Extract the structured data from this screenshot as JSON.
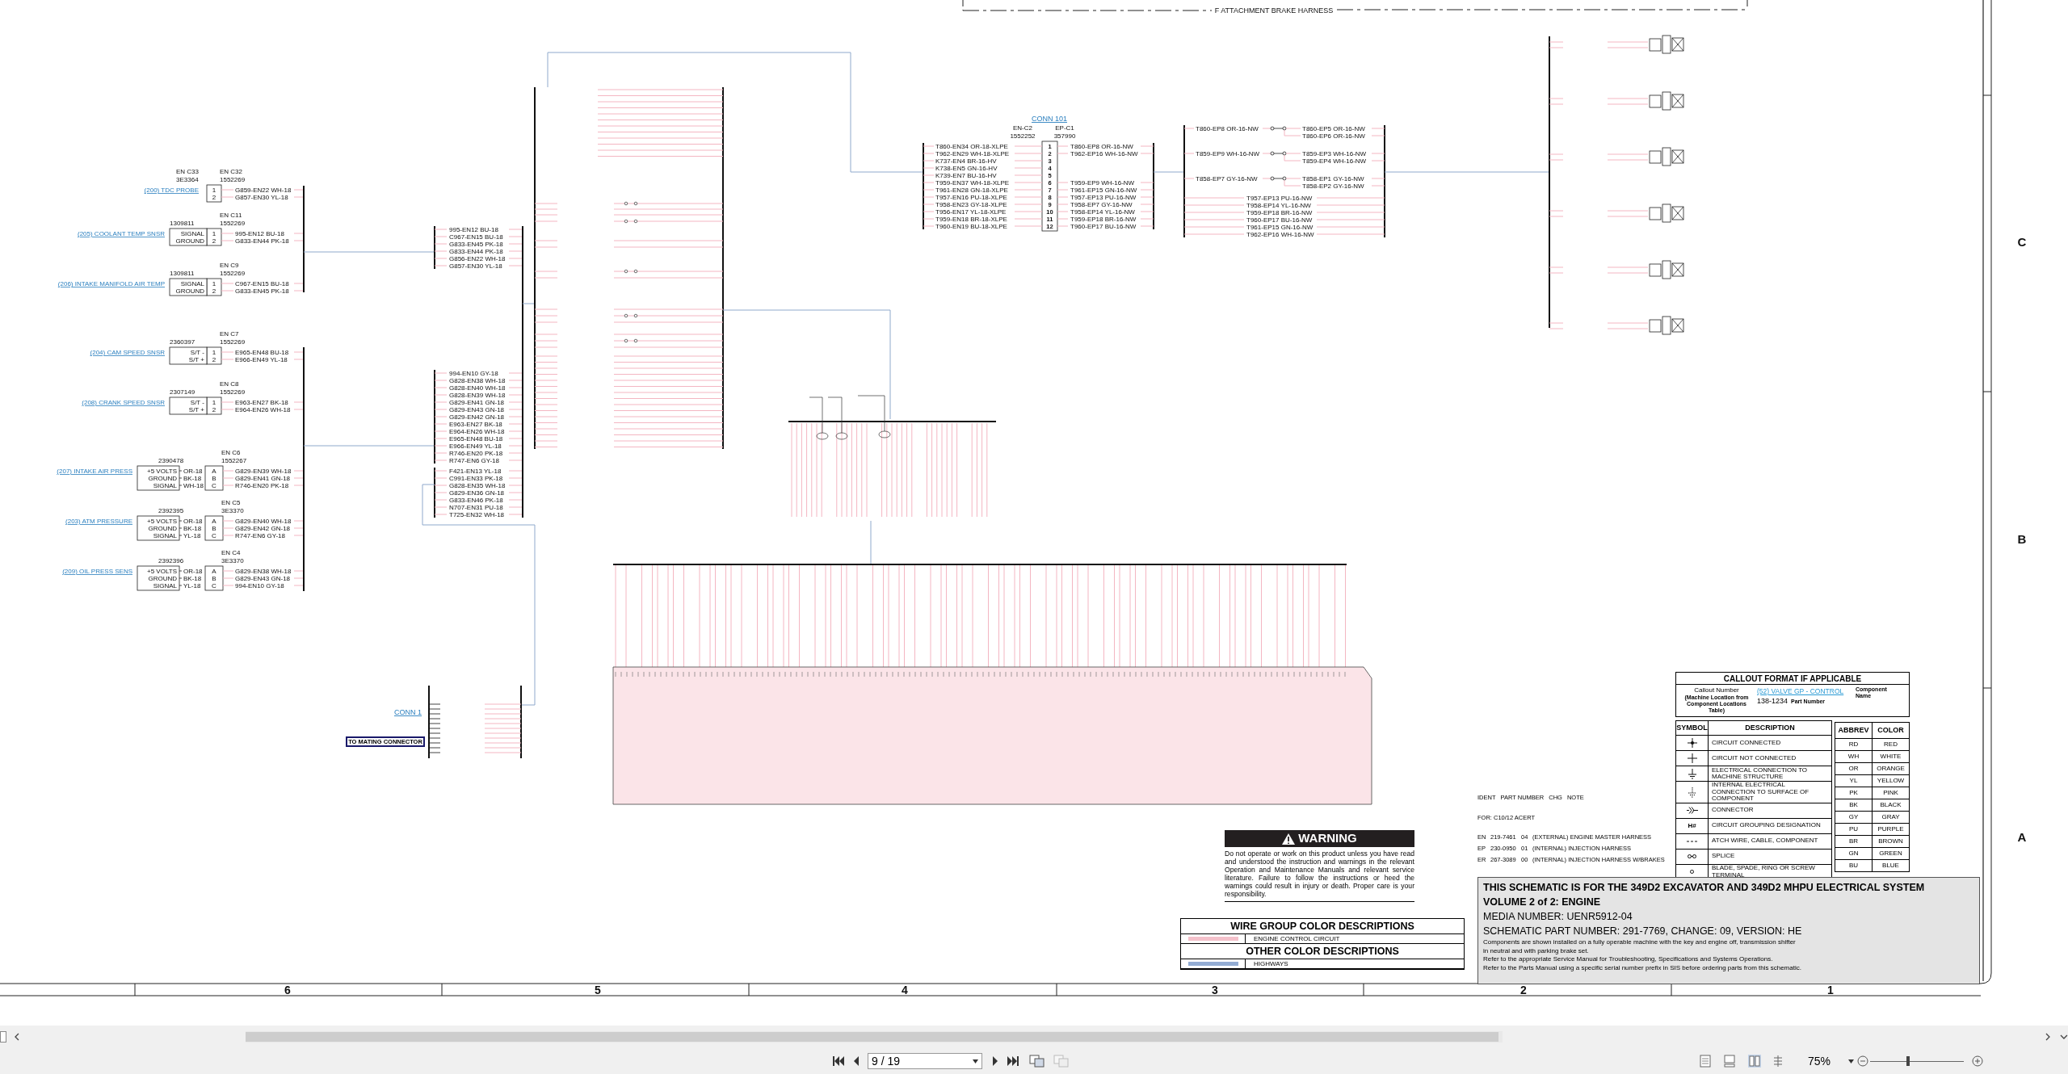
{
  "harness_frame": {
    "label": "F ATTACHMENT BRAKE HARNESS"
  },
  "sensors": [
    {
      "kind": "probe",
      "link": "(200) TDC PROBE",
      "ident": "EN C33",
      "part": "3E3364",
      "connector": "EN C32",
      "connector_part": "1552269",
      "pins": [
        "1",
        "2"
      ],
      "wires": [
        "G859-EN22 WH-18",
        "G857-EN30 YL-18"
      ]
    },
    {
      "kind": "two_wire",
      "link": "(205) COOLANT TEMP SNSR",
      "part": "1309811",
      "connector": "EN C11",
      "connector_part": "1552269",
      "signals": [
        "SIGNAL",
        "GROUND"
      ],
      "pins": [
        "1",
        "2"
      ],
      "wires": [
        "995-EN12 BU-18",
        "G833-EN44 PK-18"
      ]
    },
    {
      "kind": "two_wire",
      "link": "(206) INTAKE MANIFOLD AIR TEMP",
      "part": "1309811",
      "connector": "EN C9",
      "connector_part": "1552269",
      "signals": [
        "SIGNAL",
        "GROUND"
      ],
      "pins": [
        "1",
        "2"
      ],
      "wires": [
        "C967-EN15 BU-18",
        "G833-EN45 PK-18"
      ]
    },
    {
      "kind": "two_wire",
      "link": "(204) CAM SPEED SNSR",
      "part": "2360397",
      "connector": "EN C7",
      "connector_part": "1552269",
      "signals": [
        "S/T -",
        "S/T +"
      ],
      "pins": [
        "1",
        "2"
      ],
      "wires": [
        "E965-EN48 BU-18",
        "E966-EN49 YL-18"
      ]
    },
    {
      "kind": "two_wire",
      "link": "(208) CRANK SPEED SNSR",
      "part": "2307149",
      "connector": "EN C8",
      "connector_part": "1552269",
      "signals": [
        "S/T -",
        "S/T +"
      ],
      "pins": [
        "1",
        "2"
      ],
      "wires": [
        "E963-EN27 BK-18",
        "E964-EN26 WH-18"
      ]
    },
    {
      "kind": "three_wire",
      "link": "(207) INTAKE AIR PRESS",
      "part": "2390478",
      "connector": "EN C6",
      "connector_part": "1552267",
      "signals": [
        {
          "name": "+5 VOLTS",
          "wire": "OR-18"
        },
        {
          "name": "GROUND",
          "wire": "BK-18"
        },
        {
          "name": "SIGNAL",
          "wire": "WH-18"
        }
      ],
      "pins": [
        "A",
        "B",
        "C"
      ],
      "wires": [
        "G829-EN39 WH-18",
        "G829-EN41 GN-18",
        "R746-EN20 PK-18"
      ]
    },
    {
      "kind": "three_wire",
      "link": "(203) ATM PRESSURE",
      "part": "2392395",
      "connector": "EN C5",
      "connector_part": "3E3370",
      "signals": [
        {
          "name": "+5 VOLTS",
          "wire": "OR-18"
        },
        {
          "name": "GROUND",
          "wire": "BK-18"
        },
        {
          "name": "SIGNAL",
          "wire": "YL-18"
        }
      ],
      "pins": [
        "A",
        "B",
        "C"
      ],
      "wires": [
        "G829-EN40 WH-18",
        "G829-EN42 GN-18",
        "R747-EN6 GY-18"
      ]
    },
    {
      "kind": "three_wire",
      "link": "(209) OIL PRESS SENS",
      "part": "2392396",
      "connector": "EN C4",
      "connector_part": "3E3370",
      "signals": [
        {
          "name": "+5 VOLTS",
          "wire": "OR-18"
        },
        {
          "name": "GROUND",
          "wire": "BK-18"
        },
        {
          "name": "SIGNAL",
          "wire": "YL-18"
        }
      ],
      "pins": [
        "A",
        "B",
        "C"
      ],
      "wires": [
        "G829-EN38 WH-18",
        "G829-EN43 GN-18",
        "994-EN10 GY-18"
      ]
    }
  ],
  "wire_groups_left": [
    [
      "995-EN12 BU-18",
      "C967-EN15 BU-18",
      "G833-EN45 PK-18",
      "G833-EN44 PK-18",
      "G856-EN22 WH-18",
      "G857-EN30 YL-18"
    ],
    [
      "994-EN10 GY-18",
      "G828-EN38 WH-18",
      "G828-EN40 WH-18",
      "G828-EN39 WH-18",
      "G829-EN41 GN-18",
      "G829-EN43 GN-18",
      "G829-EN42 GN-18",
      "E963-EN27 BK-18",
      "E964-EN26 WH-18",
      "E965-EN48 BU-18",
      "E966-EN49 YL-18",
      "R746-EN20 PK-18",
      "R747-EN6 GY-18"
    ],
    [
      "F421-EN13 YL-18",
      "C991-EN33 PK-18",
      "G828-EN35 WH-18",
      "G829-EN36 GN-18",
      "G833-EN46 PK-18",
      "N707-EN31 PU-18",
      "T725-EN32 WH-18"
    ]
  ],
  "conn_101": {
    "link": "CONN 101",
    "left_ident": "EN-C2",
    "left_part": "1552252",
    "right_ident": "EP-C1",
    "right_part": "357990",
    "pins": [
      {
        "pin": "1",
        "left": "T860-EN34 OR-18-XLPE",
        "right": "T860-EP8 OR-16-NW"
      },
      {
        "pin": "2",
        "left": "T962-EN29 WH-18-XLPE",
        "right": "T962-EP16 WH-16-NW"
      },
      {
        "pin": "3",
        "left": "K737-EN4 BR-16-HV"
      },
      {
        "pin": "4",
        "left": "K738-EN5 GN-16-HV"
      },
      {
        "pin": "5",
        "left": "K739-EN7 BU-16-HV"
      },
      {
        "pin": "6",
        "left": "T959-EN37 WH-18-XLPE",
        "right": "T959-EP9 WH-16-NW"
      },
      {
        "pin": "7",
        "left": "T961-EN28 GN-18-XLPE",
        "right": "T961-EP15 GN-16-NW"
      },
      {
        "pin": "8",
        "left": "T957-EN16 PU-18-XLPE",
        "right": "T957-EP13 PU-16-NW"
      },
      {
        "pin": "9",
        "left": "T958-EN23 GY-18-XLPE",
        "right": "T958-EP7 GY-16-NW"
      },
      {
        "pin": "10",
        "left": "T956-EN17 YL-18-XLPE",
        "right": "T958-EP14 YL-16-NW"
      },
      {
        "pin": "11",
        "left": "T959-EN18 BR-18-XLPE",
        "right": "T959-EP18 BR-16-NW"
      },
      {
        "pin": "12",
        "left": "T960-EN19 BU-18-XLPE",
        "right": "T960-EP17 BU-16-NW"
      }
    ]
  },
  "splices": [
    {
      "in": "T860-EP8 OR-16-NW",
      "out": [
        "T860-EP5 OR-16-NW",
        "T860-EP6 OR-16-NW"
      ]
    },
    {
      "in": "T859-EP9 WH-16-NW",
      "out": [
        "T859-EP3 WH-16-NW",
        "T859-EP4 WH-16-NW"
      ]
    },
    {
      "in": "T858-EP7 GY-16-NW",
      "out": [
        "T858-EP1 GY-16-NW",
        "T858-EP2 GY-16-NW"
      ]
    }
  ],
  "splice_through": [
    "T957-EP13 PU-16-NW",
    "T958-EP14 YL-16-NW",
    "T959-EP18 BR-16-NW",
    "T960-EP17 BU-16-NW",
    "T961-EP15 GN-16-NW",
    "T962-EP16 WH-16-NW"
  ],
  "conn_1": {
    "link": "CONN 1",
    "mating_label": "TO MATING CONNECTOR"
  },
  "zones": {
    "columns": [
      "6",
      "5",
      "4",
      "3",
      "2",
      "1"
    ],
    "rows": [
      "C",
      "B",
      "A"
    ]
  },
  "harness_notes": {
    "header": [
      "IDENT",
      "PART NUMBER",
      "CHG",
      "NOTE"
    ],
    "for": "FOR: C10/12 ACERT",
    "rows": [
      [
        "EN",
        "219-7461",
        "04",
        "(EXTERNAL) ENGINE MASTER HARNESS"
      ],
      [
        "EP",
        "230-0950",
        "01",
        "(INTERNAL) INJECTION HARNESS"
      ],
      [
        "ER",
        "267-3089",
        "00",
        "(INTERNAL) INJECTION HARNESS W/BRAKES"
      ]
    ]
  },
  "callout_format": {
    "title": "CALLOUT FORMAT IF APPLICABLE",
    "callout_number": "Callout Number",
    "callout_note": "(Machine Location from Component Locations Table)",
    "component_link": "(52) VALVE GP - CONTROL",
    "component_note": "Component Name",
    "part_number": "138-1234",
    "part_note": "Part Number"
  },
  "symbols": {
    "headers": [
      "SYMBOL",
      "DESCRIPTION"
    ],
    "rows": [
      {
        "kind": "connected",
        "description": "CIRCUIT CONNECTED"
      },
      {
        "kind": "not_connected",
        "description": "CIRCUIT NOT CONNECTED"
      },
      {
        "kind": "ground",
        "description": "ELECTRICAL CONNECTION TO MACHINE STRUCTURE"
      },
      {
        "kind": "internal_ground",
        "description": "INTERNAL ELECTRICAL CONNECTION TO SURFACE OF COMPONENT"
      },
      {
        "kind": "connector",
        "description": "CONNECTOR"
      },
      {
        "kind": "text",
        "symbol": "H#",
        "description": "CIRCUIT GROUPING DESIGNATION"
      },
      {
        "kind": "dashed",
        "description": "ATCH WIRE, CABLE, COMPONENT"
      },
      {
        "kind": "splice",
        "description": "SPLICE"
      },
      {
        "kind": "terminal",
        "description": "BLADE, SPADE, RING OR SCREW TERMINAL"
      }
    ]
  },
  "abbreviations": {
    "headers": [
      "ABBREV",
      "COLOR"
    ],
    "rows": [
      [
        "RD",
        "RED"
      ],
      [
        "WH",
        "WHITE"
      ],
      [
        "OR",
        "ORANGE"
      ],
      [
        "YL",
        "YELLOW"
      ],
      [
        "PK",
        "PINK"
      ],
      [
        "BK",
        "BLACK"
      ],
      [
        "GY",
        "GRAY"
      ],
      [
        "PU",
        "PURPLE"
      ],
      [
        "BR",
        "BROWN"
      ],
      [
        "GN",
        "GREEN"
      ],
      [
        "BU",
        "BLUE"
      ]
    ]
  },
  "warning": {
    "title": "WARNING",
    "text": "Do not operate or work on this product unless you have read and understood the instruction and warnings in the relevant Operation and Maintenance Manuals and relevant service literature. Failure to follow the instructions or heed the warnings could result in injury or death. Proper care is your responsibility."
  },
  "wire_group_colors": {
    "title": "WIRE GROUP COLOR DESCRIPTIONS",
    "items": [
      {
        "color": "#f4c1cb",
        "label": "ENGINE CONTROL CIRCUIT"
      }
    ]
  },
  "other_colors": {
    "title": "OTHER COLOR DESCRIPTIONS",
    "items": [
      {
        "color": "#93acd3",
        "label": "HIGHWAYS"
      }
    ]
  },
  "title_block": [
    {
      "kind": "heading",
      "text": "THIS SCHEMATIC IS FOR THE 349D2 EXCAVATOR AND 349D2 MHPU ELECTRICAL SYSTEM"
    },
    {
      "kind": "heading",
      "text": "VOLUME 2 of 2: ENGINE"
    },
    {
      "kind": "large",
      "text": "MEDIA NUMBER: UENR5912-04"
    },
    {
      "kind": "large",
      "text": "SCHEMATIC PART NUMBER: 291-7769, CHANGE: 09, VERSION: HE"
    },
    {
      "kind": "body",
      "text": "Components are shown installed on a fully operable machine with the key and engine off, transmission shifter"
    },
    {
      "kind": "body",
      "text": "in neutral and with parking brake set."
    },
    {
      "kind": "body",
      "text": "Refer to the appropriate Service Manual for Troubleshooting, Specifications and Systems Operations."
    },
    {
      "kind": "body",
      "text": "Refer to the Parts Manual using a specific serial number prefix in SIS before ordering parts from this schematic."
    }
  ],
  "viewer": {
    "page_field": "9 / 19",
    "zoom": "75%",
    "zoom_slider": {
      "level": 0.4
    }
  }
}
